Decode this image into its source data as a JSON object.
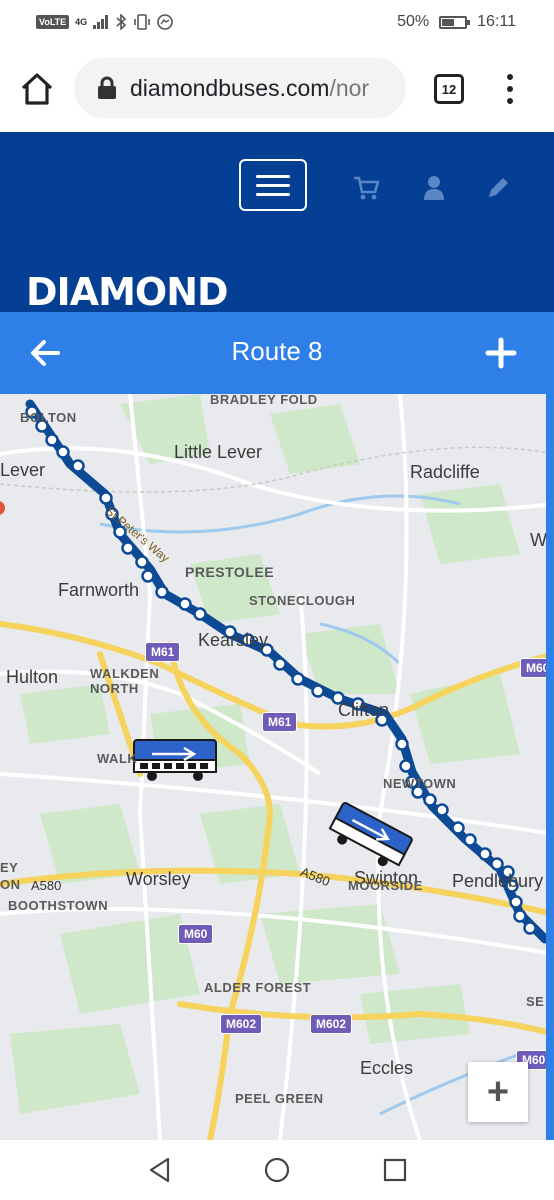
{
  "status_bar": {
    "volte": "VoLTE",
    "network": "4G",
    "battery_percent": "50%",
    "time": "16:11"
  },
  "browser": {
    "url_main": "diamondbuses.com",
    "url_rest": "/nor",
    "tab_count": "12"
  },
  "site": {
    "logo_text": "DIAMOND",
    "brand_color": "#043f93",
    "accent_color": "#2e7fe8"
  },
  "route_bar": {
    "title": "Route 8"
  },
  "map": {
    "route_color": "#0d4a96",
    "places": {
      "bolton": "BOLTON",
      "bradley_fold": "BRADLEY FOLD",
      "little_lever": "Little Lever",
      "radcliffe": "Radcliffe",
      "lever": "Lever",
      "st_peters_way": "St Peter's Way",
      "prestolee": "PRESTOLEE",
      "farnworth": "Farnworth",
      "stoneclough": "STONECLOUGH",
      "kearsley": "Kearsley",
      "hulton": "Hulton",
      "walkden_north": "WALKDEN\nNORTH",
      "walkden": "WALK",
      "clifton": "Clifton",
      "newtown": "NEWTOWN",
      "swinton": "Swinton",
      "moorside": "MOORSIDE",
      "pendlebury": "Pendlebury",
      "worsley": "Worsley",
      "boothstown": "BOOTHSTOWN",
      "alder_forest": "ALDER FOREST",
      "eccles": "Eccles",
      "peel_green": "PEEL GREEN",
      "ey": "EY",
      "on": "ON",
      "w": "W",
      "se": "SE"
    },
    "roads": {
      "m61_a": "M61",
      "m61_b": "M61",
      "m60_a": "M60",
      "m60_b": "M60",
      "m60_c": "M60",
      "m602_a": "M602",
      "m602_b": "M602",
      "a580_a": "A580",
      "a580_b": "A580"
    },
    "zoom_in_label": "+"
  }
}
